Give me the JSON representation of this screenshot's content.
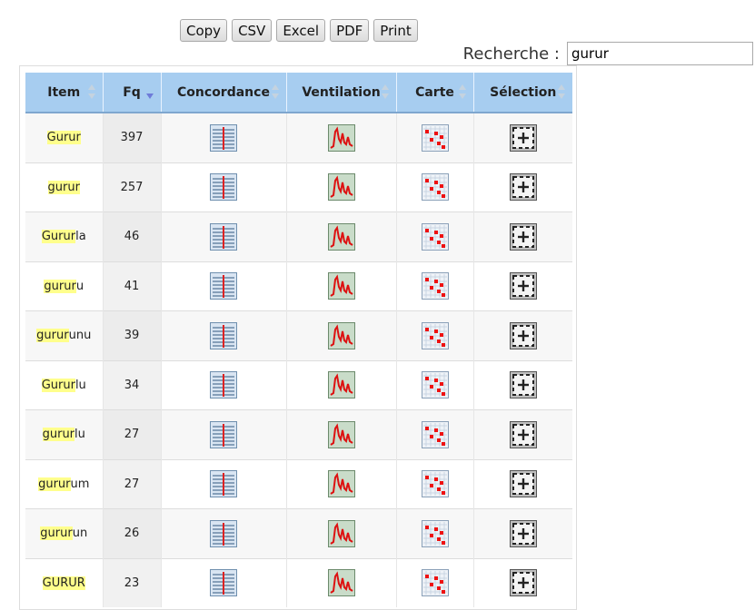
{
  "toolbar": {
    "buttons": [
      "Copy",
      "CSV",
      "Excel",
      "PDF",
      "Print"
    ]
  },
  "search": {
    "label": "Recherche :",
    "value": "gurur"
  },
  "table": {
    "columns": [
      "Item",
      "Fq",
      "Concordance",
      "Ventilation",
      "Carte",
      "Sélection"
    ],
    "sorted_column": "Fq",
    "rows": [
      {
        "match": "Gurur",
        "rest": "",
        "fq": "397"
      },
      {
        "match": "gurur",
        "rest": "",
        "fq": "257"
      },
      {
        "match": "Gurur",
        "rest": "la",
        "fq": "46"
      },
      {
        "match": "gurur",
        "rest": "u",
        "fq": "41"
      },
      {
        "match": "gurur",
        "rest": "unu",
        "fq": "39"
      },
      {
        "match": "Gurur",
        "rest": "lu",
        "fq": "34"
      },
      {
        "match": "gurur",
        "rest": "lu",
        "fq": "27"
      },
      {
        "match": "gurur",
        "rest": "um",
        "fq": "27"
      },
      {
        "match": "gurur",
        "rest": "un",
        "fq": "26"
      },
      {
        "match": "GURUR",
        "rest": "",
        "fq": "23"
      }
    ]
  },
  "icons": {
    "concordance": "concordance-icon",
    "ventilation": "ventilation-icon",
    "carte": "map-icon",
    "selection": "select-add-icon"
  },
  "colors": {
    "header_bg": "#a7cdf0",
    "highlight": "#ffff8c",
    "sort_active": "#6e7bd9"
  }
}
